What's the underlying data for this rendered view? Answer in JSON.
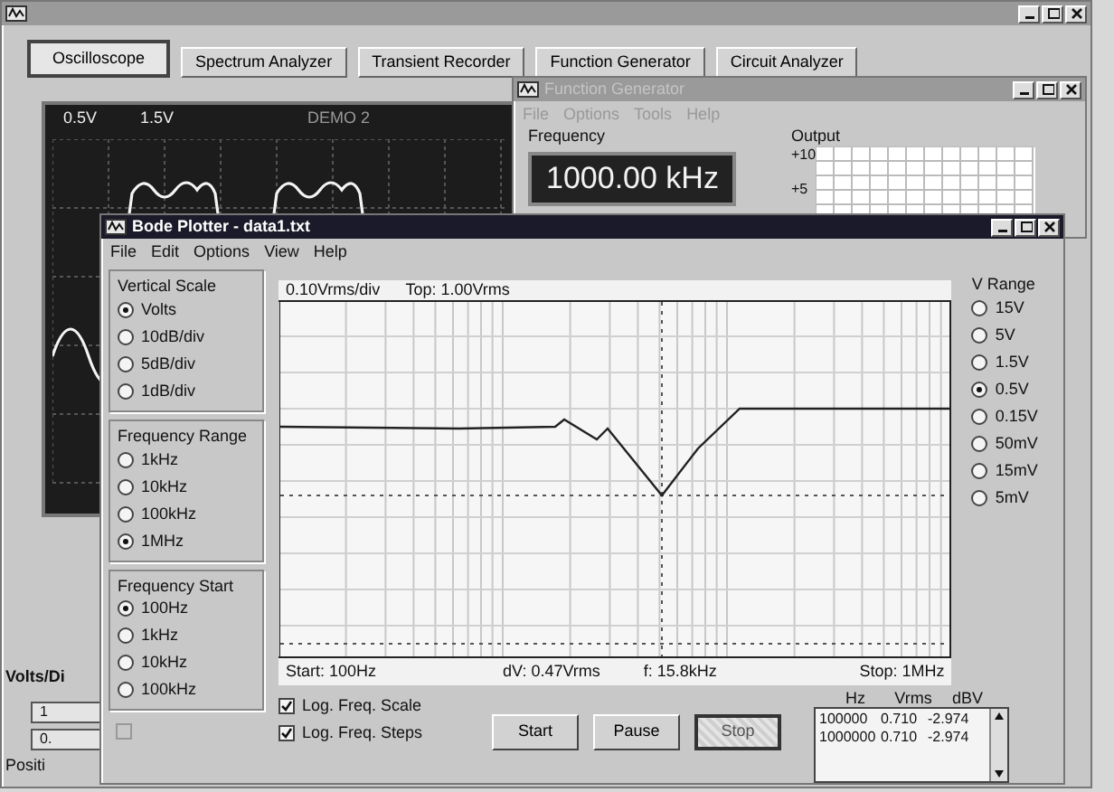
{
  "main_window": {
    "tabs": [
      {
        "label": "Oscilloscope",
        "selected": true
      },
      {
        "label": "Spectrum Analyzer",
        "selected": false
      },
      {
        "label": "Transient Recorder",
        "selected": false
      },
      {
        "label": "Function Generator",
        "selected": false
      },
      {
        "label": "Circuit Analyzer",
        "selected": false
      }
    ],
    "scope": {
      "channel_1": "0.5V",
      "channel_2": "1.5V",
      "caption": "DEMO 2"
    },
    "volts_div": {
      "title": "Volts/Di",
      "values": [
        "1",
        "0."
      ],
      "position_label": "Positi"
    }
  },
  "function_generator": {
    "title": "Function Generator",
    "menu": [
      "File",
      "Options",
      "Tools",
      "Help"
    ],
    "frequency_label": "Frequency",
    "frequency_value": "1000.00 kHz",
    "output_label": "Output",
    "output_ticks": [
      "+10",
      "+5"
    ]
  },
  "bode_plotter": {
    "title": "Bode Plotter - data1.txt",
    "menu": [
      "File",
      "Edit",
      "Options",
      "View",
      "Help"
    ],
    "groups": [
      {
        "title": "Vertical Scale",
        "options": [
          {
            "label": "Volts",
            "selected": true
          },
          {
            "label": "10dB/div",
            "selected": false
          },
          {
            "label": "5dB/div",
            "selected": false
          },
          {
            "label": "1dB/div",
            "selected": false
          }
        ]
      },
      {
        "title": "Frequency Range",
        "options": [
          {
            "label": "1kHz",
            "selected": false
          },
          {
            "label": "10kHz",
            "selected": false
          },
          {
            "label": "100kHz",
            "selected": false
          },
          {
            "label": "1MHz",
            "selected": true
          }
        ]
      },
      {
        "title": "Frequency Start",
        "options": [
          {
            "label": "100Hz",
            "selected": true
          },
          {
            "label": "1kHz",
            "selected": false
          },
          {
            "label": "10kHz",
            "selected": false
          },
          {
            "label": "100kHz",
            "selected": false
          }
        ]
      }
    ],
    "disabled_checkbox": {
      "checked": false,
      "disabled": true
    },
    "scale_label": "0.10Vrms/div",
    "top_label": "Top: 1.00Vrms",
    "start_label": "Start: 100Hz",
    "delta_label": "dV: 0.47Vrms",
    "cursor_label": "f: 15.8kHz",
    "stop_label": "Stop: 1MHz",
    "checkboxes": [
      {
        "label": "Log. Freq. Scale",
        "checked": true
      },
      {
        "label": "Log. Freq. Steps",
        "checked": true
      }
    ],
    "buttons": [
      {
        "label": "Start",
        "pressed": false
      },
      {
        "label": "Pause",
        "pressed": false
      },
      {
        "label": "Stop",
        "pressed": true
      }
    ],
    "v_range": {
      "title": "V Range",
      "options": [
        {
          "label": "15V",
          "selected": false
        },
        {
          "label": "5V",
          "selected": false
        },
        {
          "label": "1.5V",
          "selected": false
        },
        {
          "label": "0.5V",
          "selected": true
        },
        {
          "label": "0.15V",
          "selected": false
        },
        {
          "label": "50mV",
          "selected": false
        },
        {
          "label": "15mV",
          "selected": false
        },
        {
          "label": "5mV",
          "selected": false
        }
      ]
    },
    "table": {
      "columns": [
        "Hz",
        "Vrms",
        "dBV"
      ],
      "rows": [
        [
          "100000",
          "0.710",
          "-2.974"
        ],
        [
          "1000000",
          "0.710",
          "-2.974"
        ]
      ]
    }
  }
}
